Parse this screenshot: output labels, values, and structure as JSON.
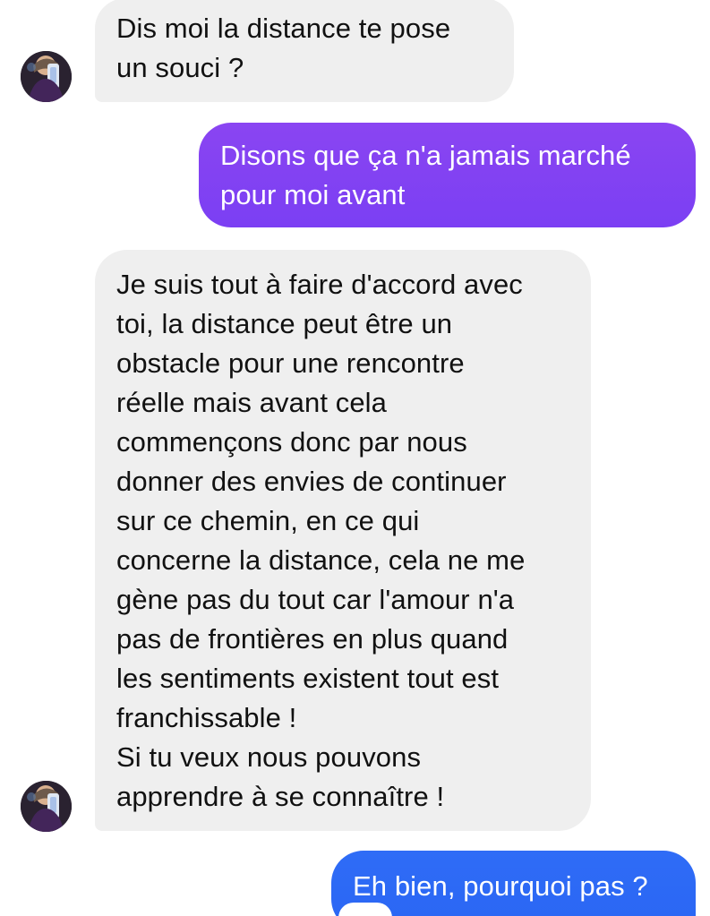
{
  "messages": [
    {
      "id": "msg1",
      "direction": "incoming",
      "text": "Dis moi la distance te pose\nun souci ?"
    },
    {
      "id": "msg2",
      "direction": "outgoing",
      "text": "Disons que ça n'a jamais marché\npour moi avant"
    },
    {
      "id": "msg3",
      "direction": "incoming",
      "text": "Je suis tout à faire d'accord avec\ntoi, la distance peut être un\nobstacle pour une rencontre\nréelle mais avant cela\ncommençons donc par nous\ndonner des envies de continuer\nsur ce chemin, en ce qui\nconcerne la distance, cela ne me\ngène pas du tout car l'amour n'a\npas de frontières en plus quand\nles sentiments existent tout est\nfranchissable !\nSi tu veux nous pouvons\napprendre à se connaître !"
    },
    {
      "id": "msg4",
      "direction": "outgoing",
      "text": "Eh bien, pourquoi pas ?"
    }
  ],
  "colors": {
    "incoming_bubble": "#efefef",
    "incoming_text": "#111111",
    "outgoing_text": "#ffffff",
    "purple_bubble": "#8a45f2",
    "blue_bubble": "#2f6cf6"
  },
  "icons": {
    "avatar": "contact-avatar-photo"
  }
}
